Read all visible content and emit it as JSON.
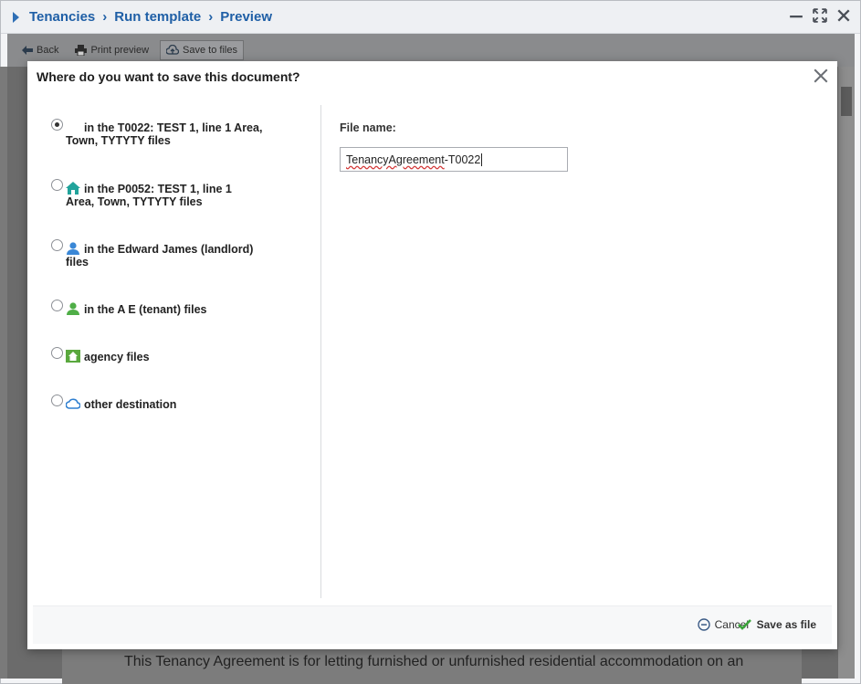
{
  "window": {
    "breadcrumb": [
      "Tenancies",
      "Run template",
      "Preview"
    ],
    "controls": [
      "minimize-icon",
      "fullscreen-icon",
      "close-icon"
    ]
  },
  "background": {
    "toolbar": {
      "back_label": "Back",
      "print_label": "Print preview",
      "save_label": "Save to files"
    },
    "document_text": "This Tenancy Agreement is for letting furnished or unfurnished residential accommodation on an"
  },
  "dialog": {
    "title": "Where do you want to save this document?",
    "options": [
      {
        "line1": "in the T0022: TEST 1, line 1 Area,",
        "line2": "Town, TYTYTY files",
        "icon": "none",
        "checked": true
      },
      {
        "line1": "in the P0052: TEST 1, line 1",
        "line2": "Area, Town, TYTYTY files",
        "icon": "property-house-icon",
        "checked": false
      },
      {
        "line1": "in the Edward James (landlord)",
        "line2": "files",
        "icon": "landlord-person-icon",
        "checked": false
      },
      {
        "line1": "in the A E (tenant) files",
        "line2": "",
        "icon": "tenant-person-icon",
        "checked": false
      },
      {
        "line1": "agency files",
        "line2": "",
        "icon": "agency-house-icon",
        "checked": false
      },
      {
        "line1": "other destination",
        "line2": "",
        "icon": "cloud-icon",
        "checked": false
      }
    ],
    "file_name_label": "File name:",
    "file_name_value_part1": "TenancyAgreement",
    "file_name_value_part2": "-T0022",
    "cancel_label": "Cancel",
    "save_label": "Save as file"
  },
  "colors": {
    "breadcrumb": "#1f5fa6",
    "property_icon": "#21a39b",
    "landlord_icon": "#3a87d6",
    "tenant_icon": "#4fae47",
    "agency_icon": "#5aa83e",
    "cloud_icon": "#2f7fd0",
    "save_check": "#3aa33a"
  }
}
